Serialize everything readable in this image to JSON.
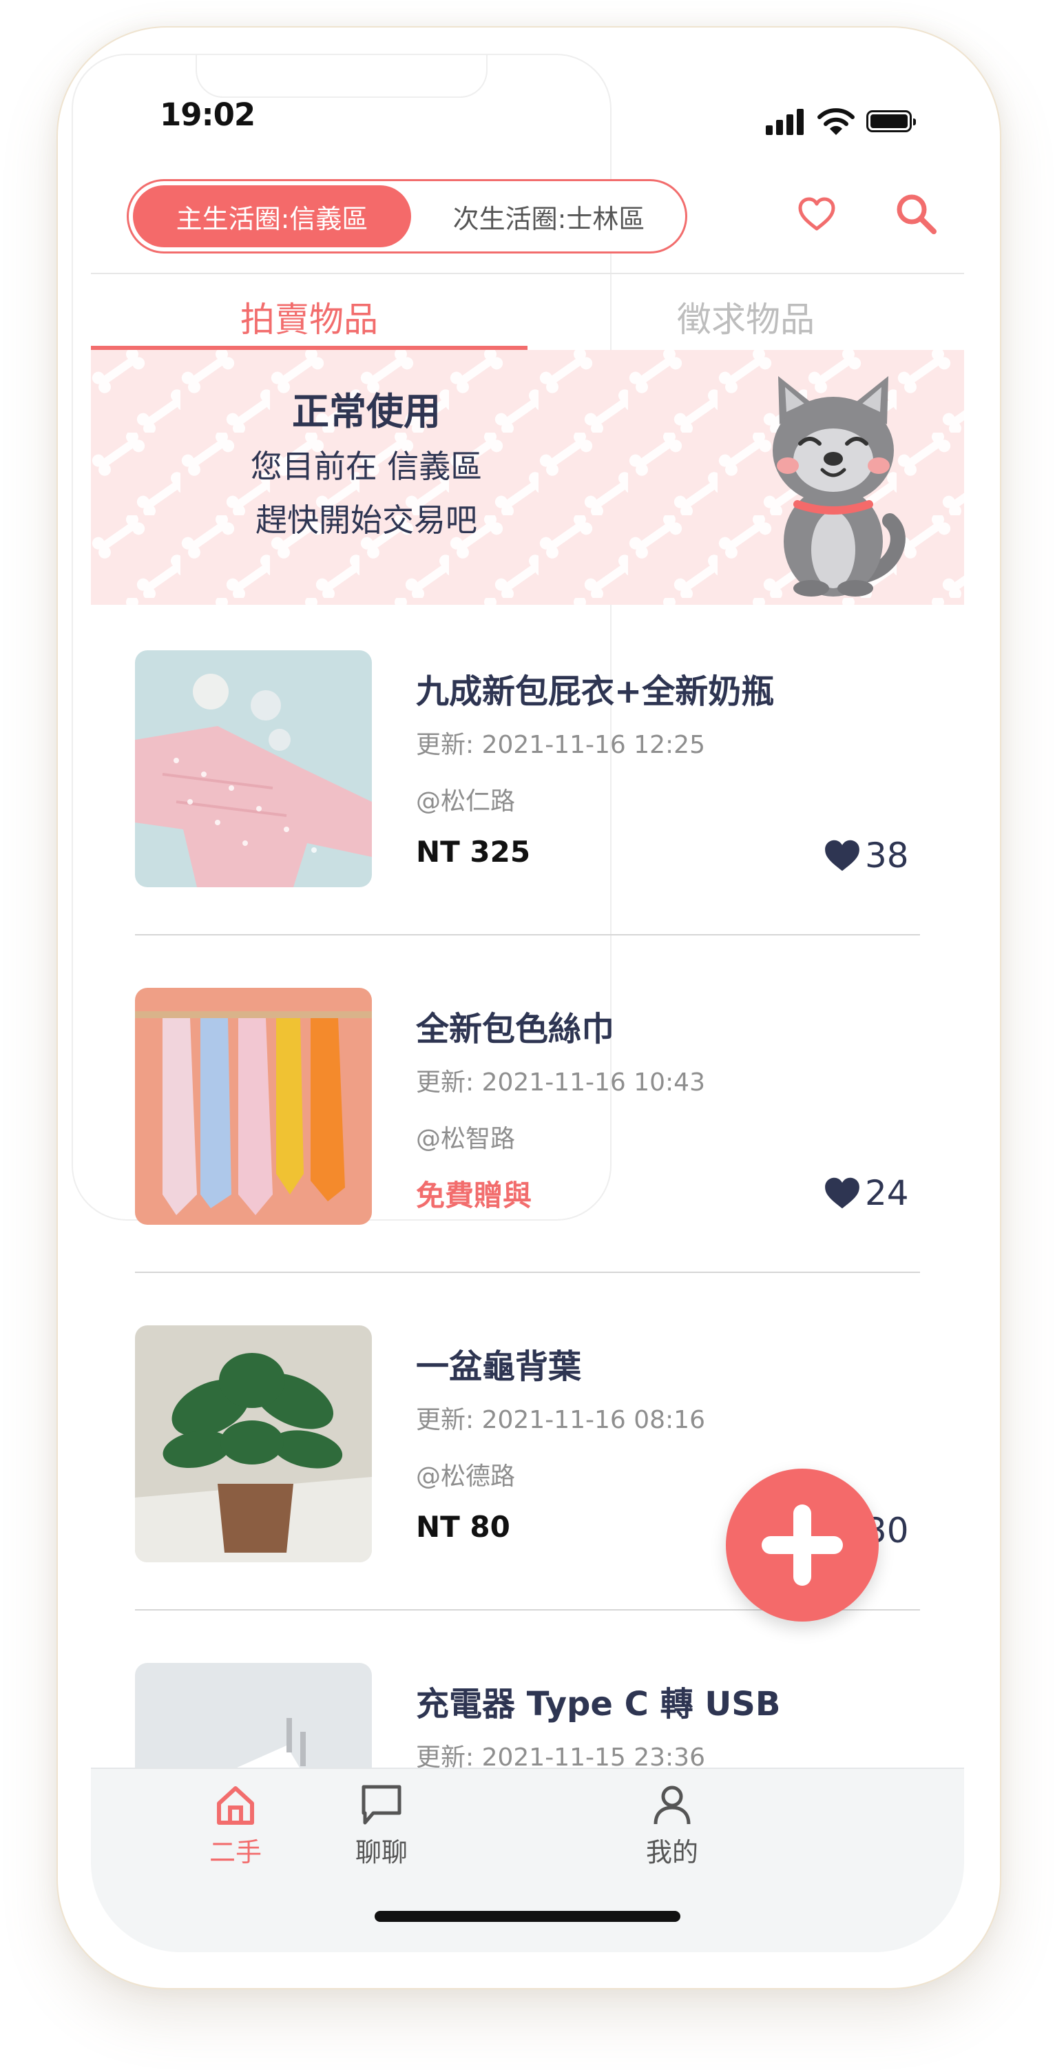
{
  "status_bar": {
    "time": "19:02"
  },
  "header": {
    "primary_area": "主生活圈:信義區",
    "secondary_area": "次生活圈:士林區",
    "icons": [
      "heart-icon",
      "search-icon"
    ]
  },
  "tabs": [
    {
      "label": "拍賣物品",
      "active": true
    },
    {
      "label": "徵求物品",
      "active": false
    }
  ],
  "banner": {
    "title": "正常使用",
    "line1": "您目前在 信義區",
    "line2": "趕快開始交易吧"
  },
  "listings": [
    {
      "title": "九成新包屁衣+全新奶瓶",
      "updated": "更新: 2021-11-16 12:25",
      "location": "@松仁路",
      "price": "NT 325",
      "likes": "38",
      "image": "pink-baby-onesie-and-bottles"
    },
    {
      "title": "全新包色絲巾",
      "updated": "更新: 2021-11-16 10:43",
      "location": "@松智路",
      "price": "免費贈與",
      "likes": "24",
      "image": "colorful-hanging-scarves"
    },
    {
      "title": "一盆龜背葉",
      "updated": "更新: 2021-11-16 08:16",
      "location": "@松德路",
      "price": "NT 80",
      "likes": "30",
      "image": "monstera-potted-plant"
    },
    {
      "title": "充電器 Type C 轉 USB",
      "updated": "更新: 2021-11-15 23:36",
      "image": "white-usb-charger"
    }
  ],
  "bottom_nav": [
    {
      "label": "二手",
      "icon": "home-icon",
      "active": true
    },
    {
      "label": "聊聊",
      "icon": "chat-icon",
      "active": false
    },
    {
      "label": "我的",
      "icon": "user-icon",
      "active": false
    }
  ],
  "colors": {
    "accent": "#f26d6d",
    "text_dark": "#2e3552",
    "muted": "#8e8e8e",
    "banner_bg": "#fde8e8"
  }
}
